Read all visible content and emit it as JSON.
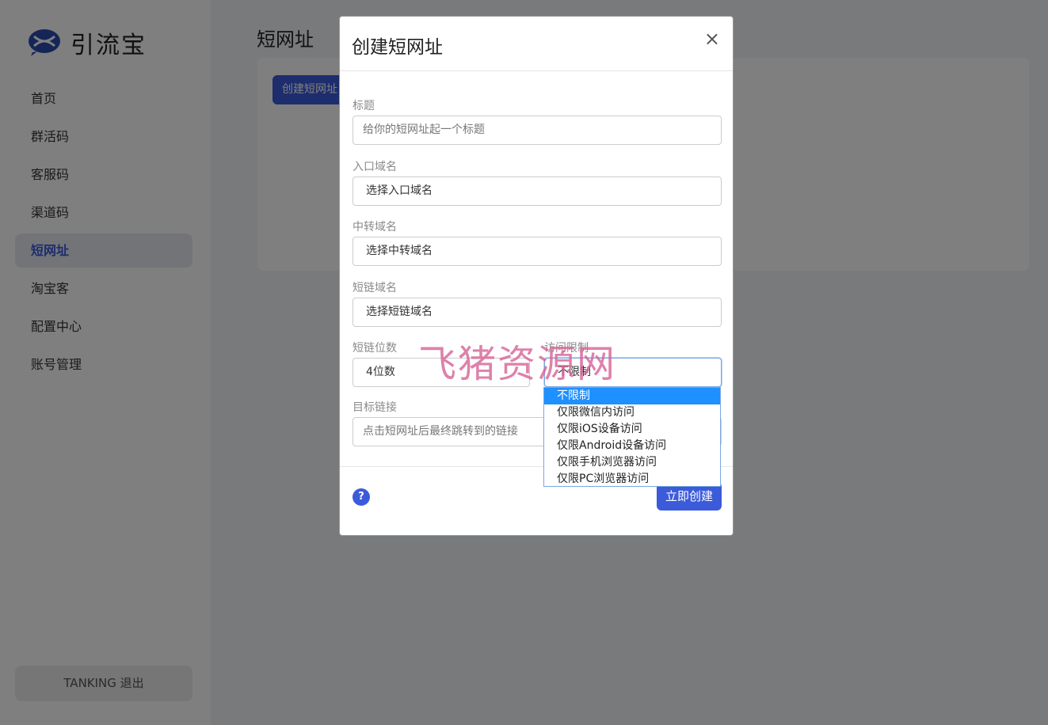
{
  "app": {
    "logo_text": "引流宝"
  },
  "sidebar": {
    "items": [
      {
        "label": "首页"
      },
      {
        "label": "群活码"
      },
      {
        "label": "客服码"
      },
      {
        "label": "渠道码"
      },
      {
        "label": "短网址"
      },
      {
        "label": "淘宝客"
      },
      {
        "label": "配置中心"
      },
      {
        "label": "账号管理"
      }
    ],
    "active_index": 4,
    "logout_label": "TANKING  退出"
  },
  "main": {
    "page_title": "短网址",
    "create_button": "创建短网址"
  },
  "modal": {
    "title": "创建短网址",
    "close_icon": "×",
    "fields": {
      "title": {
        "label": "标题",
        "placeholder": "给你的短网址起一个标题"
      },
      "entry_domain": {
        "label": "入口域名",
        "value": "选择入口域名"
      },
      "relay_domain": {
        "label": "中转域名",
        "value": "选择中转域名"
      },
      "short_domain": {
        "label": "短链域名",
        "value": "选择短链域名"
      },
      "short_digits": {
        "label": "短链位数",
        "value": "4位数"
      },
      "access_limit": {
        "label": "访问限制",
        "value": "不限制"
      },
      "target_link": {
        "label": "目标链接",
        "placeholder": "点击短网址后最终跳转到的链接"
      }
    },
    "help_icon": "?",
    "submit_label": "立即创建"
  },
  "dropdown": {
    "options": [
      "不限制",
      "仅限微信内访问",
      "仅限iOS设备访问",
      "仅限Android设备访问",
      "仅限手机浏览器访问",
      "仅限PC浏览器访问"
    ],
    "selected_index": 0
  },
  "watermark": "飞猪资源网",
  "colors": {
    "accent": "#3b5bdb",
    "dropdown_highlight": "#1e90ff"
  }
}
